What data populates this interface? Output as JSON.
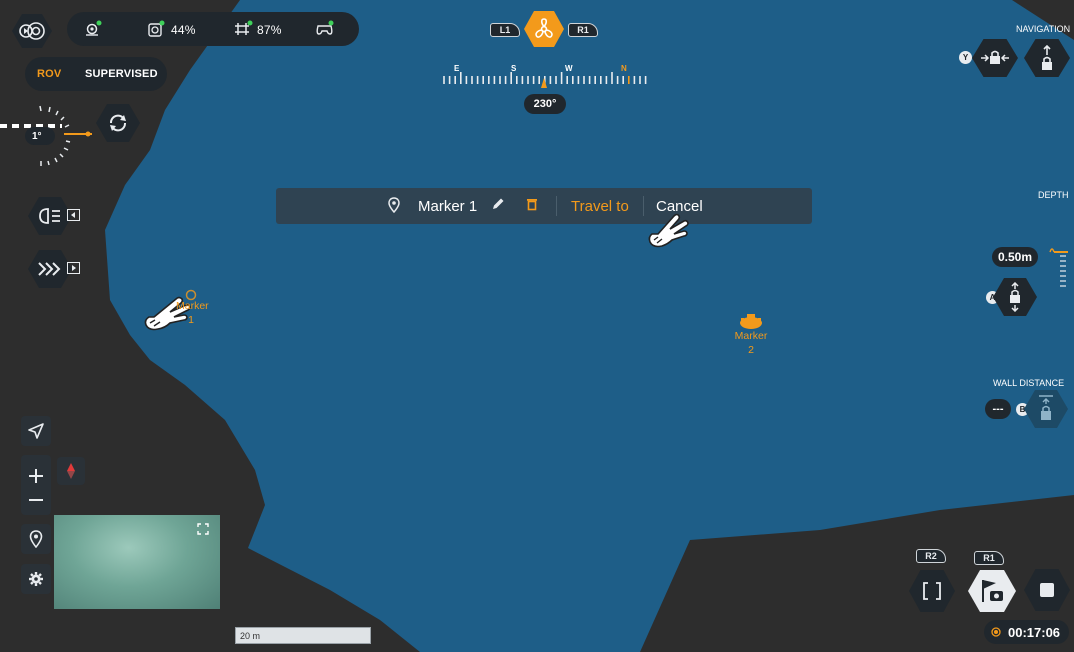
{
  "colors": {
    "water": "#1f5f8a",
    "land": "#2c2c2c",
    "accent": "#f39a1b",
    "panel": "#20272d",
    "light": "#e9ecef"
  },
  "status_bar": {
    "logo_icon": "drone-logo-icon",
    "items": [
      {
        "icon": "location-signal-icon",
        "value": ""
      },
      {
        "icon": "drone-battery-icon",
        "value": "44%"
      },
      {
        "icon": "controller-battery-icon",
        "value": "87%"
      },
      {
        "icon": "gamepad-icon",
        "value": ""
      }
    ]
  },
  "mode_toggle": {
    "active": "ROV",
    "inactive": "SUPERVISED"
  },
  "pitch_gauge": {
    "value": "1°"
  },
  "top_controls": {
    "left_bumper": "L1",
    "right_bumper": "R1",
    "center_icon": "propeller-icon"
  },
  "compass": {
    "letters": [
      "E",
      "S",
      "W",
      "N"
    ],
    "heading": "230°"
  },
  "marker_popup": {
    "title": "Marker 1",
    "travel_label": "Travel to",
    "cancel_label": "Cancel"
  },
  "markers": [
    {
      "name": "Marker",
      "number": "1"
    },
    {
      "name": "Marker",
      "number": "2"
    }
  ],
  "right_panel": {
    "navigation_label": "NAVIGATION",
    "navigation_button": "Y",
    "depth_label": "DEPTH",
    "depth_value": "0.50m",
    "depth_button": "A",
    "wall_label": "WALL DISTANCE",
    "wall_value": "---",
    "wall_button": "B"
  },
  "bottom_right": {
    "left_bumper": "R2",
    "right_bumper": "R1",
    "timer": "00:17:06"
  },
  "scale_bar": {
    "label": "20 m"
  }
}
